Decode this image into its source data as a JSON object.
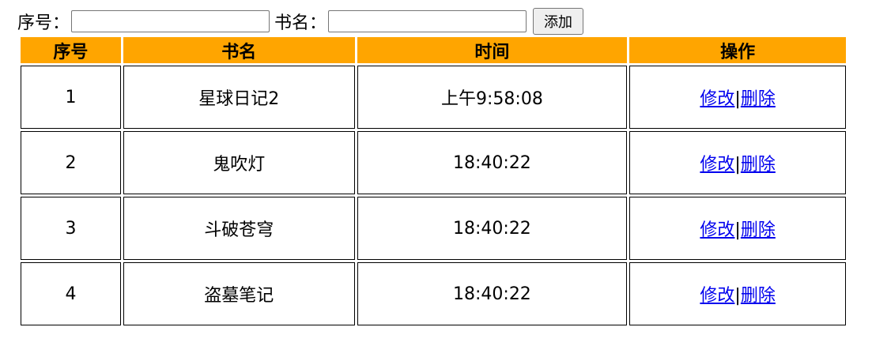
{
  "form": {
    "index_label": "序号：",
    "index_value": "",
    "name_label": "书名：",
    "name_value": "",
    "add_button": "添加"
  },
  "table": {
    "headers": [
      "序号",
      "书名",
      "时间",
      "操作"
    ],
    "rows": [
      {
        "index": "1",
        "name": "星球日记2",
        "time": "上午9:58:08",
        "edit": "修改",
        "sep": "|",
        "delete": "删除"
      },
      {
        "index": "2",
        "name": "鬼吹灯",
        "time": "18:40:22",
        "edit": "修改",
        "sep": "|",
        "delete": "删除"
      },
      {
        "index": "3",
        "name": "斗破苍穹",
        "time": "18:40:22",
        "edit": "修改",
        "sep": "|",
        "delete": "删除"
      },
      {
        "index": "4",
        "name": "盗墓笔记",
        "time": "18:40:22",
        "edit": "修改",
        "sep": "|",
        "delete": "删除"
      }
    ]
  },
  "colors": {
    "header_bg": "#ffa500",
    "link": "#0000ee"
  }
}
